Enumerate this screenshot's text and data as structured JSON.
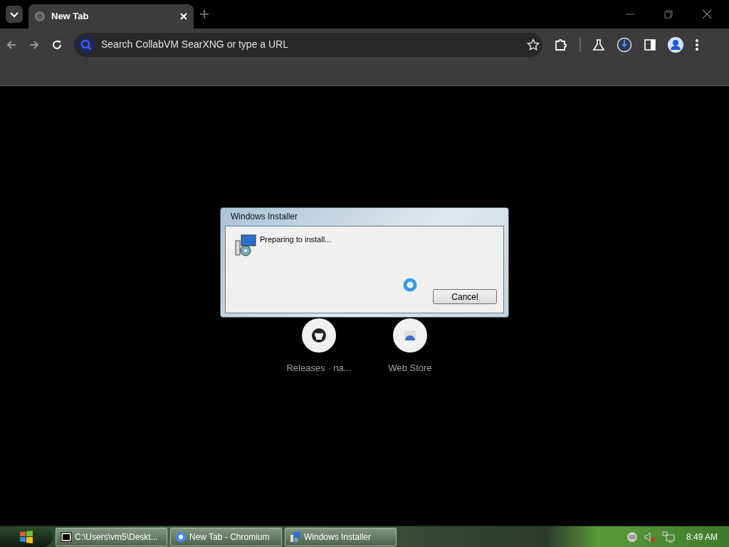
{
  "browser": {
    "tabs": [
      {
        "title": "New Tab",
        "selected": true
      }
    ],
    "address_bar": {
      "placeholder": "Search CollabVM SearXNG or type a URL"
    }
  },
  "shortcuts": [
    {
      "label": "Releases · na...",
      "kind": "github"
    },
    {
      "label": "Web Store",
      "kind": "store"
    }
  ],
  "dialog": {
    "title": "Windows Installer",
    "message": "Preparing to install...",
    "buttons": [
      "Cancel"
    ]
  },
  "taskbar": {
    "tasks": [
      {
        "label": "C:\\Users\\vm5\\Deskt...",
        "kind": "archive"
      },
      {
        "label": "New Tab - Chromium",
        "kind": "browser"
      },
      {
        "label": "Windows Installer",
        "kind": "installer"
      }
    ],
    "clock": "8:49 AM"
  }
}
